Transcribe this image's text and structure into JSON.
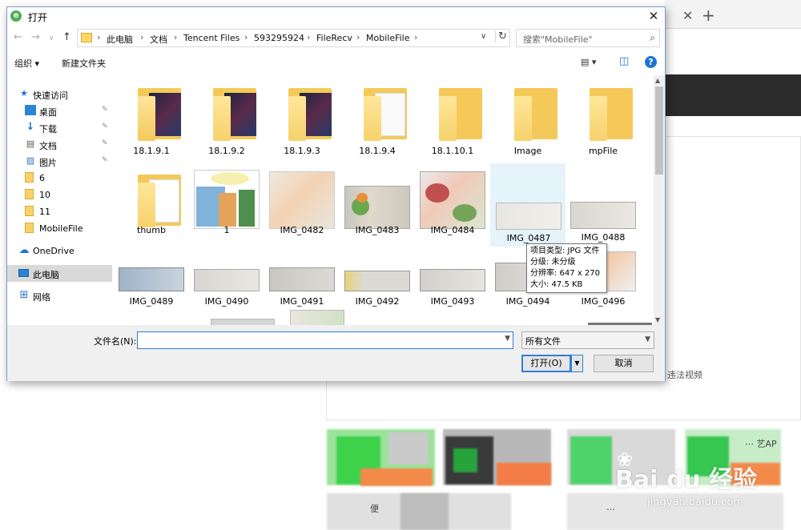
{
  "dialog": {
    "title": "打开",
    "close_glyph": "✕"
  },
  "nav": {
    "back": "←",
    "forward": "→",
    "recent": "∨",
    "up": "↑"
  },
  "address": {
    "crumbs": [
      "此电脑",
      "文档",
      "Tencent Files",
      "593295924",
      "FileRecv",
      "MobileFile"
    ],
    "separator": "›",
    "refresh": "↻",
    "dropdown": "∨"
  },
  "search": {
    "placeholder": "搜索\"MobileFile\"",
    "icon": "⌕"
  },
  "toolbar": {
    "organize": "组织 ▾",
    "new_folder": "新建文件夹",
    "view_glyph": "▤ ▾",
    "pane_glyph": "◫",
    "help": "?"
  },
  "navpane": {
    "items": [
      {
        "label": "快速访问",
        "icon": "star-icon",
        "glyph": "★",
        "pinned": false
      },
      {
        "label": "桌面",
        "icon": "desktop-icon",
        "glyph": "▭",
        "pinned": true
      },
      {
        "label": "下载",
        "icon": "download-icon",
        "glyph": "↓",
        "pinned": true
      },
      {
        "label": "文档",
        "icon": "document-icon",
        "glyph": "▤",
        "pinned": true
      },
      {
        "label": "图片",
        "icon": "picture-icon",
        "glyph": "▨",
        "pinned": true
      },
      {
        "label": "6",
        "icon": "folder-icon",
        "glyph": "",
        "pinned": false
      },
      {
        "label": "10",
        "icon": "folder-icon",
        "glyph": "",
        "pinned": false
      },
      {
        "label": "11",
        "icon": "folder-icon",
        "glyph": "",
        "pinned": false
      },
      {
        "label": "MobileFile",
        "icon": "folder-icon",
        "glyph": "",
        "pinned": false
      },
      {
        "label": "OneDrive",
        "icon": "cloud-icon",
        "glyph": "☁",
        "pinned": false
      },
      {
        "label": "此电脑",
        "icon": "computer-icon",
        "glyph": "▭",
        "pinned": false
      },
      {
        "label": "网络",
        "icon": "network-icon",
        "glyph": "⊞",
        "pinned": false
      }
    ],
    "pin_glyph": "✎"
  },
  "files": [
    {
      "name": "18.1.9.1",
      "kind": "folder-dark"
    },
    {
      "name": "18.1.9.2",
      "kind": "folder-dark"
    },
    {
      "name": "18.1.9.3",
      "kind": "folder-dark"
    },
    {
      "name": "18.1.9.4",
      "kind": "folder-paper"
    },
    {
      "name": "18.1.10.1",
      "kind": "folder"
    },
    {
      "name": "Image",
      "kind": "folder"
    },
    {
      "name": "mpFile",
      "kind": "folder"
    },
    {
      "name": "thumb",
      "kind": "folder-white"
    },
    {
      "name": "1",
      "kind": "cartoon"
    },
    {
      "name": "IMG_0482",
      "kind": "photo-orange"
    },
    {
      "name": "IMG_0483",
      "kind": "photo-gray"
    },
    {
      "name": "IMG_0484",
      "kind": "photo-color"
    },
    {
      "name": "IMG_0487",
      "kind": "photo-light"
    },
    {
      "name": "IMG_0488",
      "kind": "photo-light"
    },
    {
      "name": "IMG_0489",
      "kind": "photo-blue"
    },
    {
      "name": "IMG_0490",
      "kind": "photo-light"
    },
    {
      "name": "IMG_0491",
      "kind": "photo-light"
    },
    {
      "name": "IMG_0492",
      "kind": "photo-yellow"
    },
    {
      "name": "IMG_0493",
      "kind": "photo-light"
    },
    {
      "name": "IMG_0494",
      "kind": "photo-light"
    },
    {
      "name": "IMG_0496",
      "kind": "photo-white"
    }
  ],
  "tooltip": {
    "lines": [
      "项目类型: JPG 文件",
      "分级: 未分级",
      "分辨率: 647 x 270",
      "大小: 47.5 KB"
    ]
  },
  "bottom": {
    "filename_label": "文件名(N):",
    "filename_value": "",
    "filetype": "所有文件",
    "open": "打开(O)",
    "cancel": "取消"
  },
  "background": {
    "tab_close": "✕",
    "tab_new": "+",
    "report_text": "违法视频",
    "snippet_left": "便",
    "snippet_mid": "…",
    "snippet_right": "⋯ 艺AP"
  },
  "watermark": {
    "logo": "Bai du 经验",
    "url": "jingyan.baidu.com"
  }
}
